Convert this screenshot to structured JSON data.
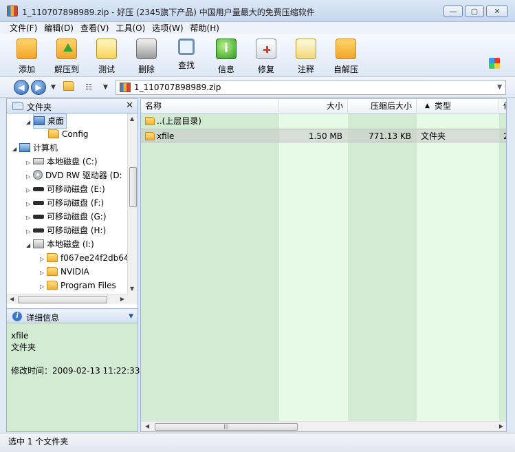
{
  "window": {
    "title": "1_110707898989.zip - 好压 (2345旗下产品) 中国用户量最大的免费压缩软件",
    "controls": {
      "minimize": "▭",
      "maximize": "▢",
      "close": "✕"
    }
  },
  "menu": [
    "文件(F)",
    "编辑(D)",
    "查看(V)",
    "工具(O)",
    "选项(W)",
    "帮助(H)"
  ],
  "toolbar": [
    {
      "label": "添加",
      "icon": "add-folder-icon"
    },
    {
      "label": "解压到",
      "icon": "extract-folder-icon"
    },
    {
      "label": "测试",
      "icon": "test-clipboard-icon"
    },
    {
      "label": "删除",
      "icon": "trash-icon"
    },
    {
      "label": "查找",
      "icon": "magnifier-icon"
    },
    {
      "label": "信息",
      "icon": "info-icon"
    },
    {
      "label": "修复",
      "icon": "first-aid-icon"
    },
    {
      "label": "注释",
      "icon": "note-icon"
    },
    {
      "label": "自解压",
      "icon": "sfx-folder-icon"
    }
  ],
  "address": {
    "path": "1_110707898989.zip"
  },
  "left_pane": {
    "header": "文件夹",
    "tree": [
      {
        "label": "桌面",
        "icon": "desktop-icon",
        "selected": true
      },
      {
        "label": "Config",
        "icon": "folder-icon"
      },
      {
        "label": "计算机",
        "icon": "computer-icon"
      },
      {
        "label": "本地磁盘 (C:)",
        "icon": "disk-icon"
      },
      {
        "label": "DVD RW 驱动器 (D:",
        "icon": "dvd-icon"
      },
      {
        "label": "可移动磁盘 (E:)",
        "icon": "usb-icon"
      },
      {
        "label": "可移动磁盘 (F:)",
        "icon": "usb-icon"
      },
      {
        "label": "可移动磁盘 (G:)",
        "icon": "usb-icon"
      },
      {
        "label": "可移动磁盘 (H:)",
        "icon": "usb-icon"
      },
      {
        "label": "本地磁盘 (I:)",
        "icon": "system-disk-icon"
      },
      {
        "label": "f067ee24f2db64",
        "icon": "folder-icon"
      },
      {
        "label": "NVIDIA",
        "icon": "folder-icon"
      },
      {
        "label": "Program Files",
        "icon": "folder-icon"
      }
    ],
    "details_header": "详细信息",
    "details": {
      "name": "xfile",
      "type": "文件夹",
      "modified": "修改时间：2009-02-13 11:22:33"
    }
  },
  "file_list": {
    "columns": [
      "名称",
      "大小",
      "压缩后大小",
      "类型",
      "修"
    ],
    "rows": [
      {
        "name": "..(上层目录)",
        "size": "",
        "packed": "",
        "type": "",
        "extra": ""
      },
      {
        "name": "xfile",
        "size": "1.50 MB",
        "packed": "771.13 KB",
        "type": "文件夹",
        "extra": "2",
        "selected": true
      }
    ]
  },
  "status": {
    "text": "选中 1 个文件夹"
  }
}
